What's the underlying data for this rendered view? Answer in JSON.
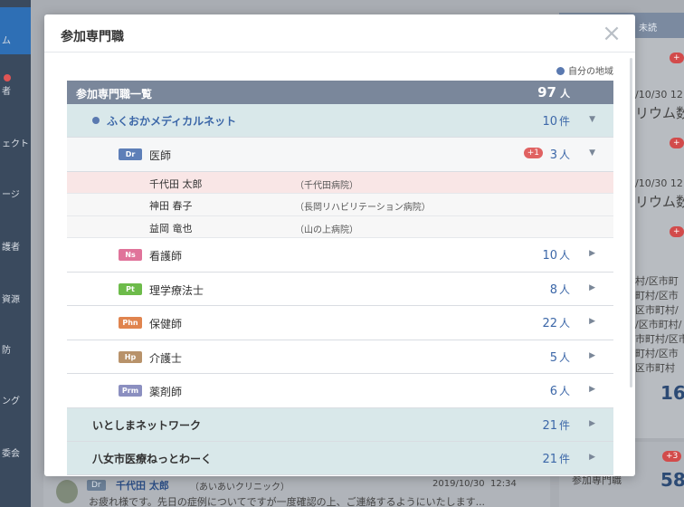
{
  "background": {
    "sidebar_items": [
      "ム",
      "者",
      "ェクト",
      "ージ",
      "護者",
      "資源",
      "防",
      "ング",
      "委会"
    ],
    "right_header": "未読",
    "right_texts": [
      "/10/30  12",
      "リウム数",
      "/10/30  12",
      "リウム数",
      "村/区市町",
      "町村/区市",
      "区市町村/",
      "/区市町村/",
      "市町村/区市",
      "町村/区市",
      "区市町村"
    ],
    "right_big_number": "16",
    "right_bottom_badge": "+3",
    "right_bottom_label": "参加専門職",
    "right_bottom_number": "58",
    "message": {
      "badge": "Dr",
      "sender": "千代田 太郎",
      "clinic": "（あいあいクリニック）",
      "date": "2019/10/30",
      "time": "12:34",
      "text": "お疲れ様です。先日の症例についてですが一度確認の上、ご連絡するようにいたします..."
    }
  },
  "modal": {
    "title": "参加専門職",
    "close_icon": "×",
    "legend_label": "自分の地域",
    "list_header_label": "参加専門職一覧",
    "list_header_count": "97",
    "list_header_unit": "人",
    "networks": [
      {
        "name": "ふくおかメディカルネット",
        "count": "10",
        "unit": "件",
        "mine": true,
        "expanded": true
      },
      {
        "name": "いとしまネットワーク",
        "count": "21",
        "unit": "件",
        "mine": false,
        "expanded": false
      },
      {
        "name": "八女市医療ねっとわーく",
        "count": "21",
        "unit": "件",
        "mine": false,
        "expanded": false
      }
    ],
    "professions": [
      {
        "badge": "Dr",
        "color": "#5e7fb8",
        "name": "医師",
        "count": "3",
        "unit": "人",
        "plus": "+1",
        "expanded": true
      },
      {
        "badge": "Ns",
        "color": "#e0739a",
        "name": "看護師",
        "count": "10",
        "unit": "人"
      },
      {
        "badge": "Pt",
        "color": "#6dbb4a",
        "name": "理学療法士",
        "count": "8",
        "unit": "人"
      },
      {
        "badge": "Phn",
        "color": "#e0844e",
        "name": "保健師",
        "count": "22",
        "unit": "人"
      },
      {
        "badge": "Hp",
        "color": "#b8926a",
        "name": "介護士",
        "count": "5",
        "unit": "人"
      },
      {
        "badge": "Prm",
        "color": "#8b8fc0",
        "name": "薬剤師",
        "count": "6",
        "unit": "人"
      }
    ],
    "doctors": [
      {
        "name": "千代田 太郎",
        "hospital": "（千代田病院）",
        "highlight": true
      },
      {
        "name": "神田 春子",
        "hospital": "（長岡リハビリテーション病院）",
        "highlight": false
      },
      {
        "name": "益岡 竜也",
        "hospital": "（山の上病院）",
        "highlight": false
      }
    ]
  }
}
